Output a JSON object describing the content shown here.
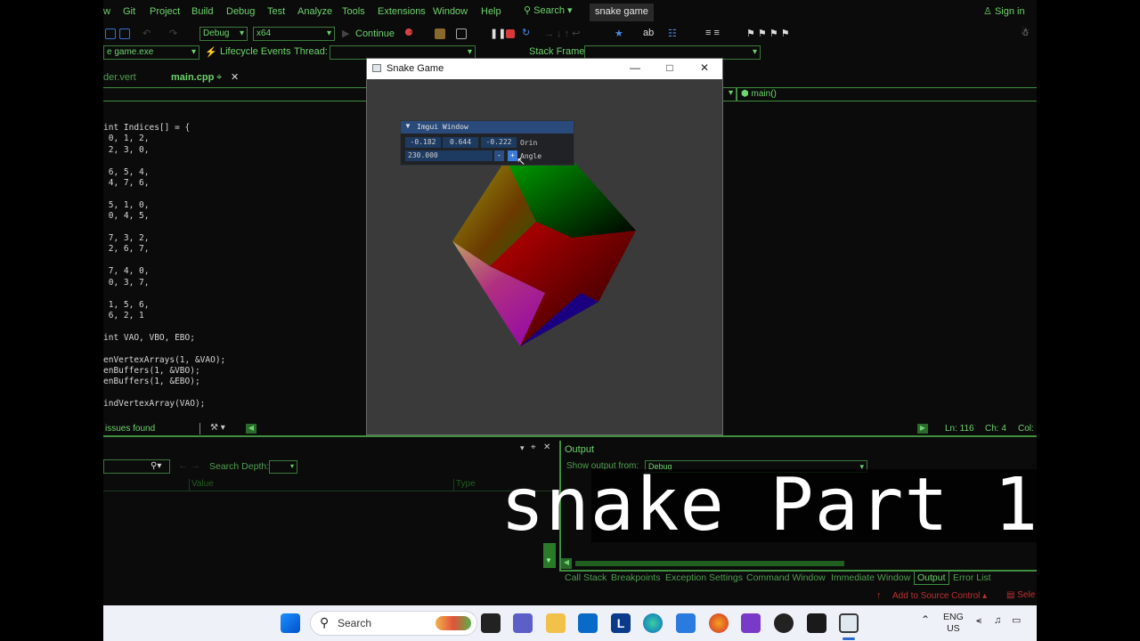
{
  "menubar": {
    "items": [
      "w",
      "Git",
      "Project",
      "Build",
      "Debug",
      "Test",
      "Analyze",
      "Tools",
      "Extensions",
      "Window",
      "Help"
    ],
    "search_label": "Search",
    "solution_name": "snake game",
    "sign_in": "Sign in"
  },
  "toolbar": {
    "config": "Debug",
    "platform": "x64",
    "continue_label": "Continue"
  },
  "toolbar2": {
    "process": "e game.exe",
    "lifecycle": "Lifecycle Events",
    "thread_label": "Thread:",
    "stack_frame_label": "Stack Frame:"
  },
  "tabs": {
    "shader_tab": "der.vert",
    "main_tab": "main.cpp"
  },
  "editor": {
    "function_nav": "main()",
    "code_lines": [
      "int Indices[] = {",
      " 0, 1, 2,",
      " 2, 3, 0,",
      "",
      " 6, 5, 4,",
      " 4, 7, 6,",
      "",
      " 5, 1, 0,",
      " 0, 4, 5,",
      "",
      " 7, 3, 2,",
      " 2, 6, 7,",
      "",
      " 7, 4, 0,",
      " 0, 3, 7,",
      "",
      " 1, 5, 6,",
      " 6, 2, 1",
      "",
      "int VAO, VBO, EBO;",
      "",
      "enVertexArrays(1, &VAO);",
      "enBuffers(1, &VBO);",
      "enBuffers(1, &EBO);",
      "",
      "indVertexArray(VAO);"
    ],
    "issues": "issues found",
    "ln": "Ln: 116",
    "ch": "Ch: 4",
    "col": "Col: "
  },
  "bottom_left": {
    "search_depth_label": "Search Depth:",
    "col_value": "Value",
    "col_type": "Type"
  },
  "output": {
    "title": "Output",
    "show_output_from": "Show output from:",
    "source": "Debug"
  },
  "bottom_tabs": [
    "Call Stack",
    "Breakpoints",
    "Exception Settings",
    "Command Window",
    "Immediate Window",
    "Output",
    "Error List"
  ],
  "status": {
    "add_to_source_control": "Add to Source Control",
    "select": "Sele"
  },
  "game_window": {
    "title": "Snake Game",
    "imgui": {
      "title": "Imgui Window",
      "orin_values": [
        "-0.182",
        "0.644",
        "-0.222"
      ],
      "orin_label": "Orin",
      "angle_value": "230.000",
      "minus_label": "-",
      "plus_label": "+",
      "angle_label": "Angle"
    }
  },
  "overlay": {
    "text": "snake Part 1"
  },
  "taskbar": {
    "search_placeholder": "Search",
    "lang_line1": "ENG",
    "lang_line2": "US"
  },
  "colors": {
    "accent_green": "#6cd46c",
    "border_green": "#3f8f3f",
    "imgui_blue": "#294a7a"
  }
}
